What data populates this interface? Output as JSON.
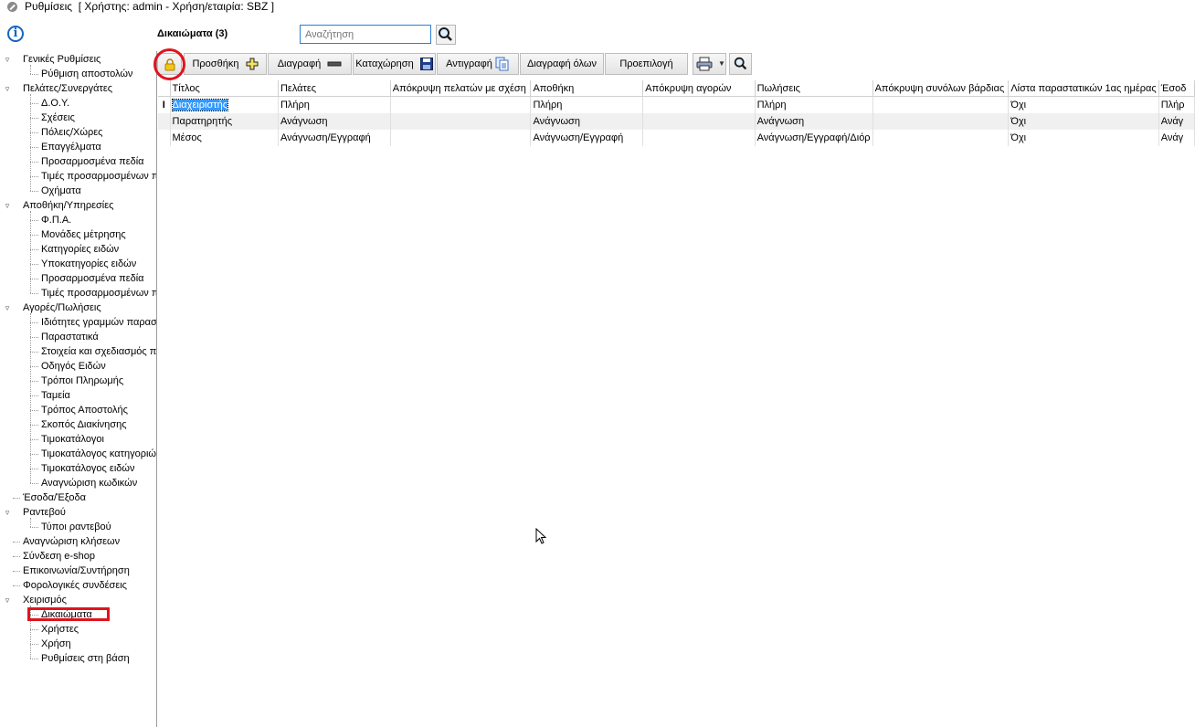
{
  "window": {
    "title": "Ρυθμίσεις  [ Χρήστης: admin - Χρήση/εταιρία: SBZ ]"
  },
  "info_icon": "i",
  "tree": {
    "items": [
      {
        "label": "Γενικές Ρυθμίσεις",
        "level": 0,
        "expander": "▿"
      },
      {
        "label": "Ρύθμιση αποστολών",
        "level": 1
      },
      {
        "label": "Πελάτες/Συνεργάτες",
        "level": 0,
        "expander": "▿"
      },
      {
        "label": "Δ.Ο.Υ.",
        "level": 1
      },
      {
        "label": "Σχέσεις",
        "level": 1
      },
      {
        "label": "Πόλεις/Χώρες",
        "level": 1
      },
      {
        "label": "Επαγγέλματα",
        "level": 1
      },
      {
        "label": "Προσαρμοσμένα πεδία",
        "level": 1
      },
      {
        "label": "Τιμές προσαρμοσμένων π",
        "level": 1
      },
      {
        "label": "Οχήματα",
        "level": 1
      },
      {
        "label": "Αποθήκη/Υπηρεσίες",
        "level": 0,
        "expander": "▿"
      },
      {
        "label": "Φ.Π.Α.",
        "level": 1
      },
      {
        "label": "Μονάδες μέτρησης",
        "level": 1
      },
      {
        "label": "Κατηγορίες ειδών",
        "level": 1
      },
      {
        "label": "Υποκατηγορίες ειδών",
        "level": 1
      },
      {
        "label": "Προσαρμοσμένα πεδία",
        "level": 1
      },
      {
        "label": "Τιμές προσαρμοσμένων π",
        "level": 1
      },
      {
        "label": "Αγορές/Πωλήσεις",
        "level": 0,
        "expander": "▿"
      },
      {
        "label": "Ιδιότητες γραμμών παρασ",
        "level": 1
      },
      {
        "label": "Παραστατικά",
        "level": 1
      },
      {
        "label": "Στοιχεία και σχεδιασμός π",
        "level": 1
      },
      {
        "label": "Οδηγός Ειδών",
        "level": 1
      },
      {
        "label": "Τρόποι Πληρωμής",
        "level": 1
      },
      {
        "label": "Ταμεία",
        "level": 1
      },
      {
        "label": "Τρόπος Αποστολής",
        "level": 1
      },
      {
        "label": "Σκοπός Διακίνησης",
        "level": 1
      },
      {
        "label": "Τιμοκατάλογοι",
        "level": 1
      },
      {
        "label": "Τιμοκατάλογος κατηγοριώ",
        "level": 1
      },
      {
        "label": "Τιμοκατάλογος ειδών",
        "level": 1
      },
      {
        "label": "Αναγνώριση κωδικών",
        "level": 1
      },
      {
        "label": "Έσοδα/Έξοδα",
        "level": 0
      },
      {
        "label": "Ραντεβού",
        "level": 0,
        "expander": "▿"
      },
      {
        "label": "Τύποι ραντεβού",
        "level": 1
      },
      {
        "label": "Αναγνώριση κλήσεων",
        "level": 0
      },
      {
        "label": "Σύνδεση e-shop",
        "level": 0
      },
      {
        "label": "Επικοινωνία/Συντήρηση",
        "level": 0
      },
      {
        "label": "Φορολογικές συνδέσεις",
        "level": 0
      },
      {
        "label": "Χειρισμός",
        "level": 0,
        "expander": "▿"
      },
      {
        "label": "Δικαιώματα",
        "level": 1,
        "selected": true
      },
      {
        "label": "Χρήστες",
        "level": 1
      },
      {
        "label": "Χρήση",
        "level": 1
      },
      {
        "label": "Ρυθμίσεις στη βάση",
        "level": 1
      }
    ]
  },
  "header": {
    "grid_title": "Δικαιώματα (3)",
    "search_placeholder": "Αναζήτηση"
  },
  "toolbar": {
    "add_label": "Προσθήκη",
    "delete_label": "Διαγραφή",
    "save_label": "Καταχώρηση",
    "copy_label": "Αντιγραφή",
    "delete_all_label": "Διαγραφή όλων",
    "default_label": "Προεπιλογή"
  },
  "grid": {
    "columns": [
      "Τίτλος",
      "Πελάτες",
      "Απόκρυψη πελατών με σχέση",
      "Αποθήκη",
      "Απόκρυψη αγορών",
      "Πωλήσεις",
      "Απόκρυψη συνόλων βάρδιας",
      "Λίστα παραστατικών 1ας ημέρας",
      "Έσοδ"
    ],
    "rows": [
      {
        "indicator": "I",
        "cells": [
          "Διαχειριστής",
          "Πλήρη",
          "",
          "Πλήρη",
          "",
          "Πλήρη",
          "",
          "Όχι",
          "Πλήρ"
        ]
      },
      {
        "indicator": "",
        "cells": [
          "Παρατηρητής",
          "Ανάγνωση",
          "",
          "Ανάγνωση",
          "",
          "Ανάγνωση",
          "",
          "Όχι",
          "Ανάγ"
        ]
      },
      {
        "indicator": "",
        "cells": [
          "Μέσος",
          "Ανάγνωση/Εγγραφή",
          "",
          "Ανάγνωση/Εγγραφή",
          "",
          "Ανάγνωση/Εγγραφή/Διόρ",
          "",
          "Όχι",
          "Ανάγ"
        ]
      }
    ]
  },
  "colors": {
    "highlight_red": "#e0141e",
    "selection_blue": "#3399ff",
    "info_blue": "#1565c0"
  }
}
